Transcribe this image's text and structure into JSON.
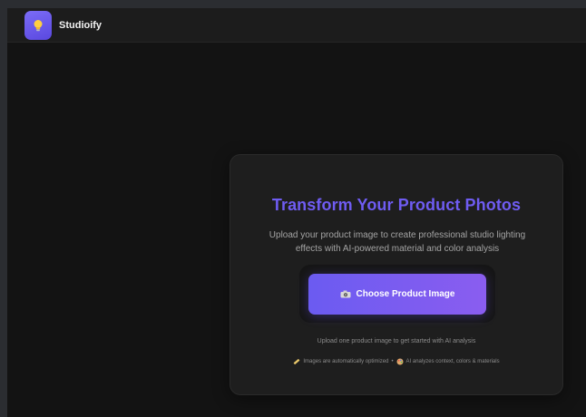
{
  "app": {
    "name": "Studioify",
    "logo_icon": "lightbulb-icon",
    "brand_color": "#6f5cf2"
  },
  "hero": {
    "title": "Transform Your Product Photos",
    "subtitle_line1": "Upload your product image to create professional studio lighting",
    "subtitle_line2": "effects with AI-powered material and color analysis"
  },
  "upload": {
    "button_icon": "camera-icon",
    "button_label": "Choose Product Image",
    "hint": "Upload one product image to get started with AI analysis",
    "note_optimized": "Images are automatically optimized",
    "note_separator": "•",
    "note_analysis": "AI analyzes context, colors & materials"
  }
}
